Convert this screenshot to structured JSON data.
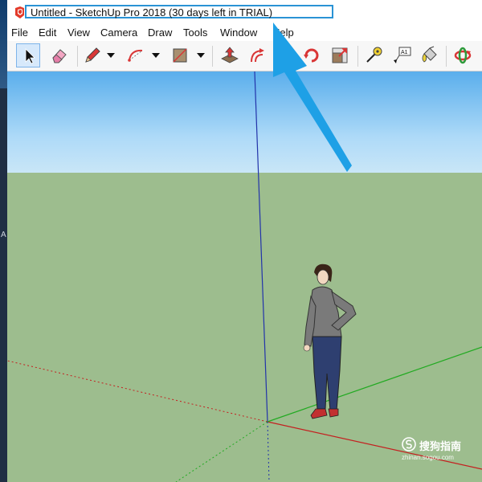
{
  "window": {
    "title": "Untitled - SketchUp Pro 2018 (30 days left in TRIAL)"
  },
  "menu": {
    "items": [
      "File",
      "Edit",
      "View",
      "Camera",
      "Draw",
      "Tools",
      "Window",
      "Help"
    ]
  },
  "toolbar": {
    "tools": [
      {
        "name": "select-tool",
        "icon": "arrow-cursor-icon",
        "active": true
      },
      {
        "name": "eraser-tool",
        "icon": "eraser-icon"
      },
      {
        "name": "line-tool",
        "icon": "pencil-icon",
        "dropdown": true
      },
      {
        "name": "arc-tool",
        "icon": "arc-icon",
        "dropdown": true
      },
      {
        "name": "rectangle-tool",
        "icon": "rectangle-icon",
        "dropdown": true
      },
      {
        "name": "push-pull-tool",
        "icon": "push-pull-icon"
      },
      {
        "name": "offset-tool",
        "icon": "offset-icon"
      },
      {
        "name": "rotate-tool",
        "icon": "rotate-icon"
      },
      {
        "name": "scale-tool",
        "icon": "scale-icon"
      },
      {
        "name": "tape-measure-tool",
        "icon": "tape-measure-icon"
      },
      {
        "name": "text-tool",
        "icon": "text-label-icon"
      },
      {
        "name": "paint-bucket-tool",
        "icon": "paint-bucket-icon"
      },
      {
        "name": "orbit-tool",
        "icon": "orbit-icon"
      }
    ],
    "text_tool_label": "A1"
  },
  "colors": {
    "accent": "#2a93d5",
    "callout": "#1ea0e6",
    "sky_top": "#5aaeec",
    "ground": "#9dbd8e",
    "axis_blue": "#2233aa",
    "axis_red": "#c42020",
    "axis_green": "#22aa22"
  },
  "watermark": {
    "brand": "搜狗指南",
    "url": "zhinan.sogou.com"
  },
  "left_strip_glyph": "A"
}
